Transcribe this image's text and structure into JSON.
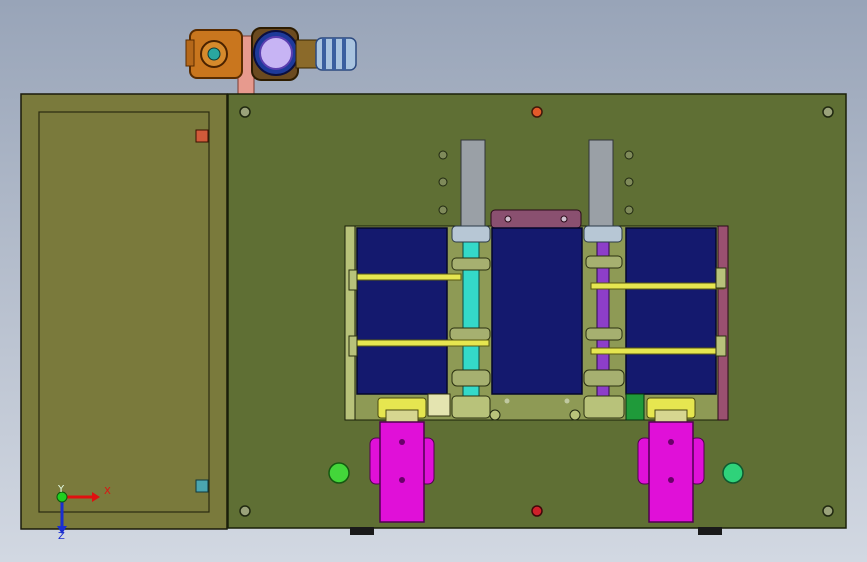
{
  "viewport": {
    "background_top": "#98a4b8",
    "background_bottom": "#d2d8e2"
  },
  "assembly": {
    "door_color": "#7a7a3c",
    "panel_color": "#5f6f34",
    "coil_color": "#14196e",
    "busbar_color": "#e6e650",
    "clamp_color": "#e010d8",
    "insulator_left_color": "#34d9c9",
    "insulator_right_color": "#8d3ec9",
    "indicator_colors": [
      "#43d63a",
      "#2fd27a"
    ]
  },
  "top_fittings": {
    "junction_box_color": "#c9761e",
    "gauge_color": "#5b3fb0",
    "coupling_color": "#a9c4e0"
  },
  "triad": {
    "x_label": "X",
    "y_label": "Y",
    "z_label": "Z"
  }
}
